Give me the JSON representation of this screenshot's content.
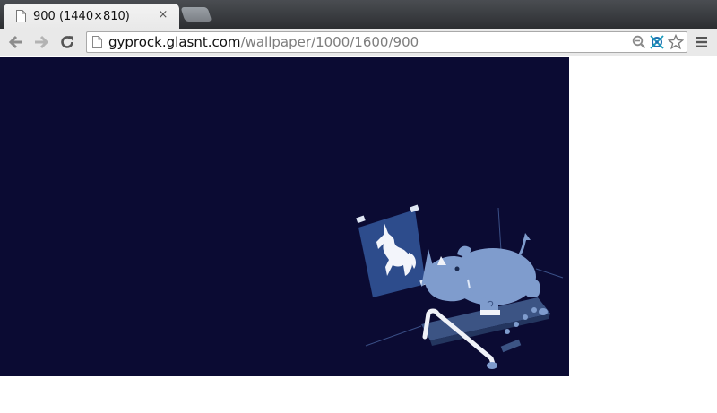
{
  "tab": {
    "title": "900 (1440×810)",
    "close": "×"
  },
  "toolbar": {
    "url_host": "gyprock.glasnt.com",
    "url_path": "/wallpaper/1000/1600/900"
  },
  "icons": {
    "tab_page": "page-icon",
    "back": "back-arrow-icon",
    "forward": "forward-arrow-icon",
    "reload": "reload-icon",
    "omnibox_page": "page-icon",
    "zoom": "magnifier-icon",
    "extension": "extension-icon",
    "bookmark": "star-icon",
    "menu": "hamburger-menu-icon"
  },
  "colors": {
    "wallpaper_bg": "#0b0b33",
    "rhino": "#7f9ccd",
    "treadmill": "#3c5484",
    "poster": "#2d4c8c"
  }
}
